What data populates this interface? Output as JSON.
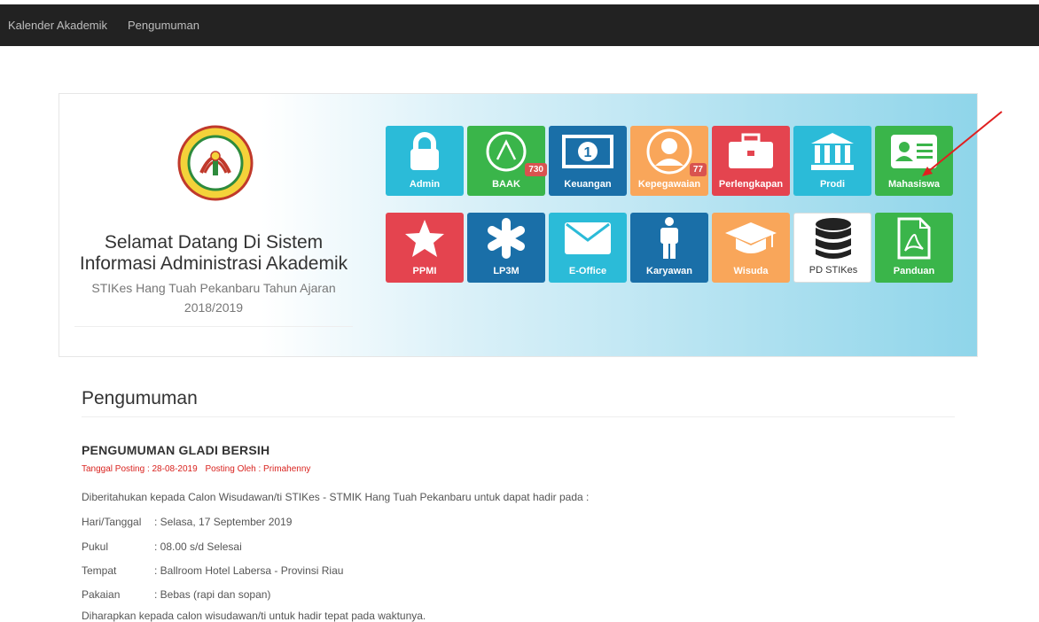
{
  "nav": {
    "items": [
      "Kalender Akademik",
      "Pengumuman"
    ]
  },
  "welcome": {
    "line1": "Selamat Datang Di Sistem",
    "line2": "Informasi Administrasi Akademik",
    "sub1": "STIKes Hang Tuah Pekanbaru Tahun Ajaran",
    "sub2": "2018/2019"
  },
  "tiles_row1": [
    {
      "label": "Admin",
      "color": "#2bbbd8",
      "icon": "lock-icon"
    },
    {
      "label": "BAAK",
      "color": "#3ab54a",
      "icon": "a-circle-icon",
      "badge": "730"
    },
    {
      "label": "Keuangan",
      "color": "#1a6fa8",
      "icon": "money-icon"
    },
    {
      "label": "Kepegawaian",
      "color": "#f9a65a",
      "icon": "user-circle-icon",
      "badge": "77"
    },
    {
      "label": "Perlengkapan",
      "color": "#e4444f",
      "icon": "briefcase-icon"
    },
    {
      "label": "Prodi",
      "color": "#2bbbd8",
      "icon": "bank-icon"
    },
    {
      "label": "Mahasiswa",
      "color": "#3ab54a",
      "icon": "id-card-icon"
    }
  ],
  "tiles_row2": [
    {
      "label": "PPMI",
      "color": "#e4444f",
      "icon": "star-icon"
    },
    {
      "label": "LP3M",
      "color": "#1a6fa8",
      "icon": "asterisk-icon"
    },
    {
      "label": "E-Office",
      "color": "#2bbbd8",
      "icon": "envelope-icon"
    },
    {
      "label": "Karyawan",
      "color": "#1a6fa8",
      "icon": "male-icon"
    },
    {
      "label": "Wisuda",
      "color": "#f9a65a",
      "icon": "graduation-cap-icon"
    },
    {
      "label": "PD STIKes",
      "color": "#ffffff",
      "icon": "database-icon"
    },
    {
      "label": "Panduan",
      "color": "#3ab54a",
      "icon": "pdf-file-icon"
    }
  ],
  "announcements": {
    "heading": "Pengumuman",
    "title": "PENGUMUMAN GLADI BERSIH",
    "date": "Tanggal Posting : 28-08-2019",
    "author": "Posting Oleh : Primahenny",
    "intro": "Diberitahukan kepada Calon Wisudawan/ti STIKes - STMIK Hang Tuah Pekanbaru untuk dapat hadir pada :",
    "details": [
      {
        "key": "Hari/Tanggal",
        "value": ": Selasa, 17 September 2019"
      },
      {
        "key": "Pukul",
        "value": ": 08.00 s/d Selesai"
      },
      {
        "key": "Tempat",
        "value": ": Ballroom Hotel Labersa - Provinsi Riau"
      },
      {
        "key": "Pakaian",
        "value": ": Bebas (rapi dan sopan)"
      }
    ],
    "closing": "Diharapkan kepada calon wisudawan/ti untuk hadir tepat pada waktunya."
  }
}
